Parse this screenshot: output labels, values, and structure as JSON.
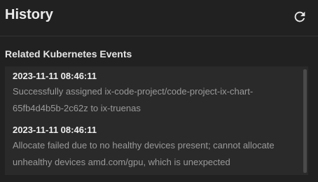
{
  "header": {
    "title": "History",
    "refresh_icon": "refresh-icon"
  },
  "section": {
    "title": "Related Kubernetes Events"
  },
  "events": [
    {
      "time": "2023-11-11 08:46:11",
      "message": "Successfully assigned ix-code-project/code-project-ix-chart-65fb4d4b5b-2c62z to ix-truenas"
    },
    {
      "time": "2023-11-11 08:46:11",
      "message": "Allocate failed due to no healthy devices present; cannot allocate unhealthy devices amd.com/gpu, which is unexpected"
    }
  ],
  "colors": {
    "background": "#212121",
    "panel": "#2a2a2a",
    "muted_text": "#9a9a9a"
  }
}
